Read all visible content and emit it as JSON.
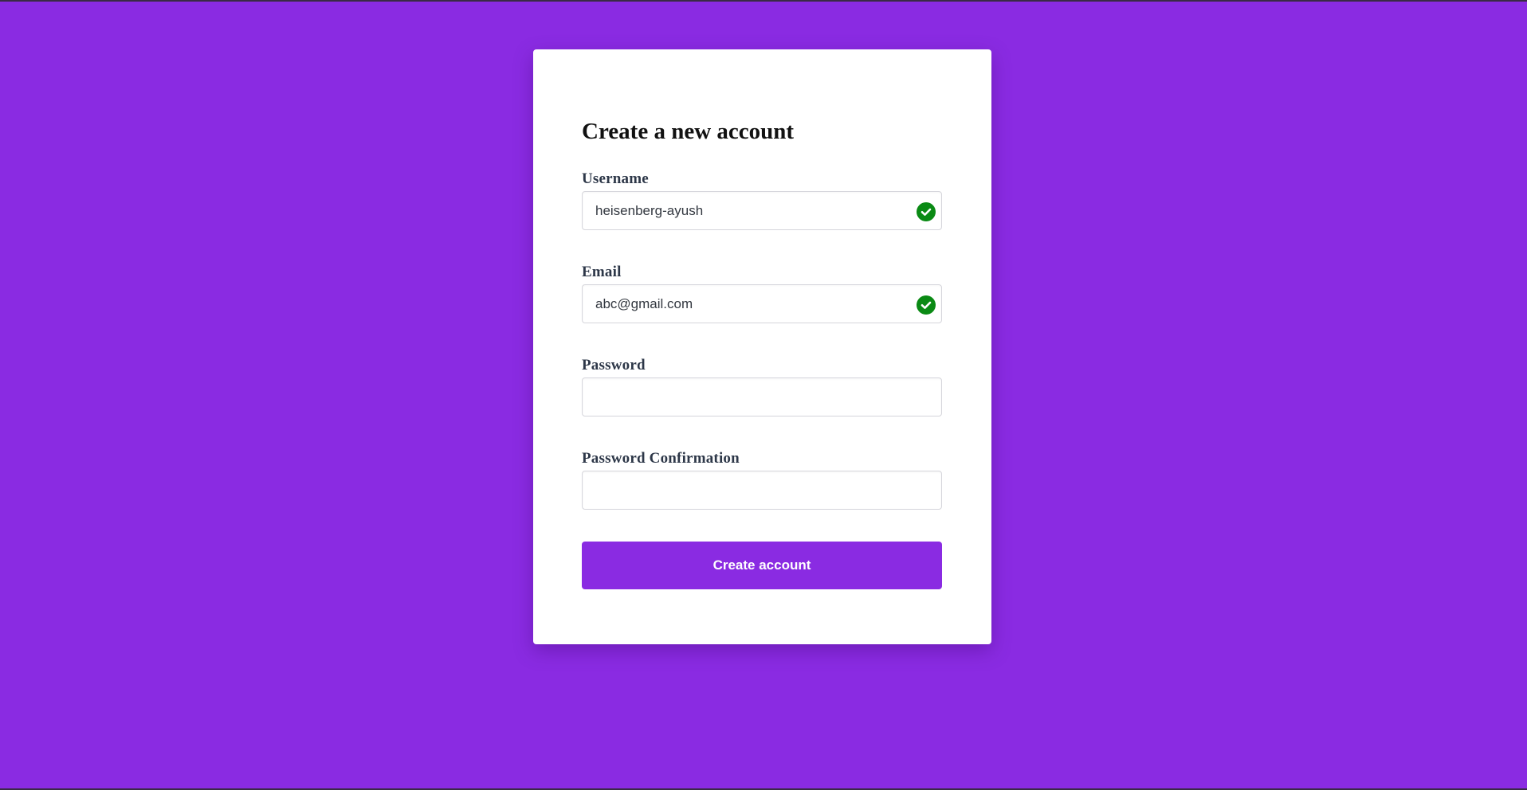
{
  "theme": {
    "background": "#8a2be2",
    "card": "#ffffff",
    "accent": "#8a2be2",
    "valid": "#0a8a14"
  },
  "form": {
    "title": "Create a new account",
    "fields": [
      {
        "label": "Username",
        "value": "heisenberg-ayush",
        "valid": true,
        "icon": "check-circle-icon"
      },
      {
        "label": "Email",
        "value": "abc@gmail.com",
        "valid": true,
        "icon": "check-circle-icon"
      },
      {
        "label": "Password",
        "value": "",
        "valid": false
      },
      {
        "label": "Password Confirmation",
        "value": "",
        "valid": false
      }
    ],
    "submit_label": "Create account"
  }
}
